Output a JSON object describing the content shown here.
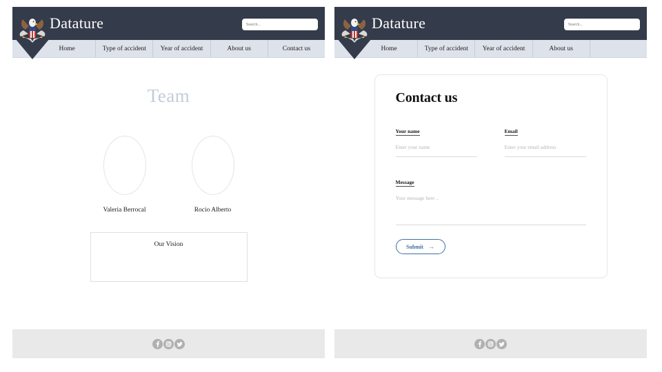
{
  "site": {
    "brand_name": "Datature",
    "logo_icon": "eagle-emblem-icon"
  },
  "left_panel": {
    "header": {
      "brand_name": "Datature",
      "search_placeholder": "Search..."
    },
    "nav": {
      "items": [
        {
          "label": "Home"
        },
        {
          "label": "Type of accident"
        },
        {
          "label": "Year of accident"
        },
        {
          "label": "About us"
        },
        {
          "label": "Contact us"
        }
      ]
    },
    "content": {
      "page_title": "Team",
      "members": [
        {
          "name": "Valeria Berrocal"
        },
        {
          "name": "Rocio Alberto"
        }
      ],
      "vision": {
        "title": "Our Vision",
        "body": ""
      }
    }
  },
  "right_panel": {
    "header": {
      "brand_name": "Datature",
      "search_placeholder": "Search..."
    },
    "nav": {
      "items": [
        {
          "label": "Home"
        },
        {
          "label": "Type of accident"
        },
        {
          "label": "Year of accident"
        },
        {
          "label": "About us"
        },
        {
          "label": ""
        }
      ]
    },
    "content": {
      "form_title": "Contact us",
      "fields": {
        "name": {
          "label": "Your name",
          "placeholder": "Enter your name",
          "value": ""
        },
        "email": {
          "label": "Email",
          "placeholder": "Enter your email address",
          "value": ""
        },
        "message": {
          "label": "Message",
          "placeholder": "Your message here ..",
          "value": ""
        }
      },
      "submit": {
        "label": "Submit",
        "arrow": "→"
      }
    }
  },
  "footer": {
    "social": [
      {
        "name": "facebook-icon"
      },
      {
        "name": "instagram-icon"
      },
      {
        "name": "twitter-icon"
      }
    ]
  },
  "colors": {
    "header_bg": "#343b4a",
    "nav_bg": "#dde2eb",
    "footer_bg": "#e9e9e9",
    "accent_blue": "#3f6ea3",
    "team_title": "#c4ccda"
  }
}
